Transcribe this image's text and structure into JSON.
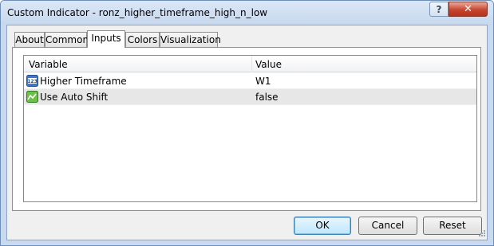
{
  "window": {
    "title": "Custom Indicator - ronz_higher_timeframe_high_n_low",
    "help_label": "?",
    "close_label": "✕"
  },
  "tabs": [
    {
      "label": "About"
    },
    {
      "label": "Common"
    },
    {
      "label": "Inputs",
      "active": true
    },
    {
      "label": "Colors"
    },
    {
      "label": "Visualization"
    }
  ],
  "grid": {
    "columns": [
      "Variable",
      "Value"
    ],
    "rows": [
      {
        "variable": "Higher Timeframe",
        "value": "W1",
        "icon": "integer-123-icon"
      },
      {
        "variable": "Use Auto Shift",
        "value": "false",
        "icon": "boolean-chart-icon"
      }
    ]
  },
  "buttons": {
    "ok": "OK",
    "cancel": "Cancel",
    "reset": "Reset"
  },
  "colors": {
    "titlebar": "#c9daf0",
    "close_button": "#c8452f",
    "default_button_border": "#3c7fb1",
    "alt_row": "#e7e7e7"
  }
}
